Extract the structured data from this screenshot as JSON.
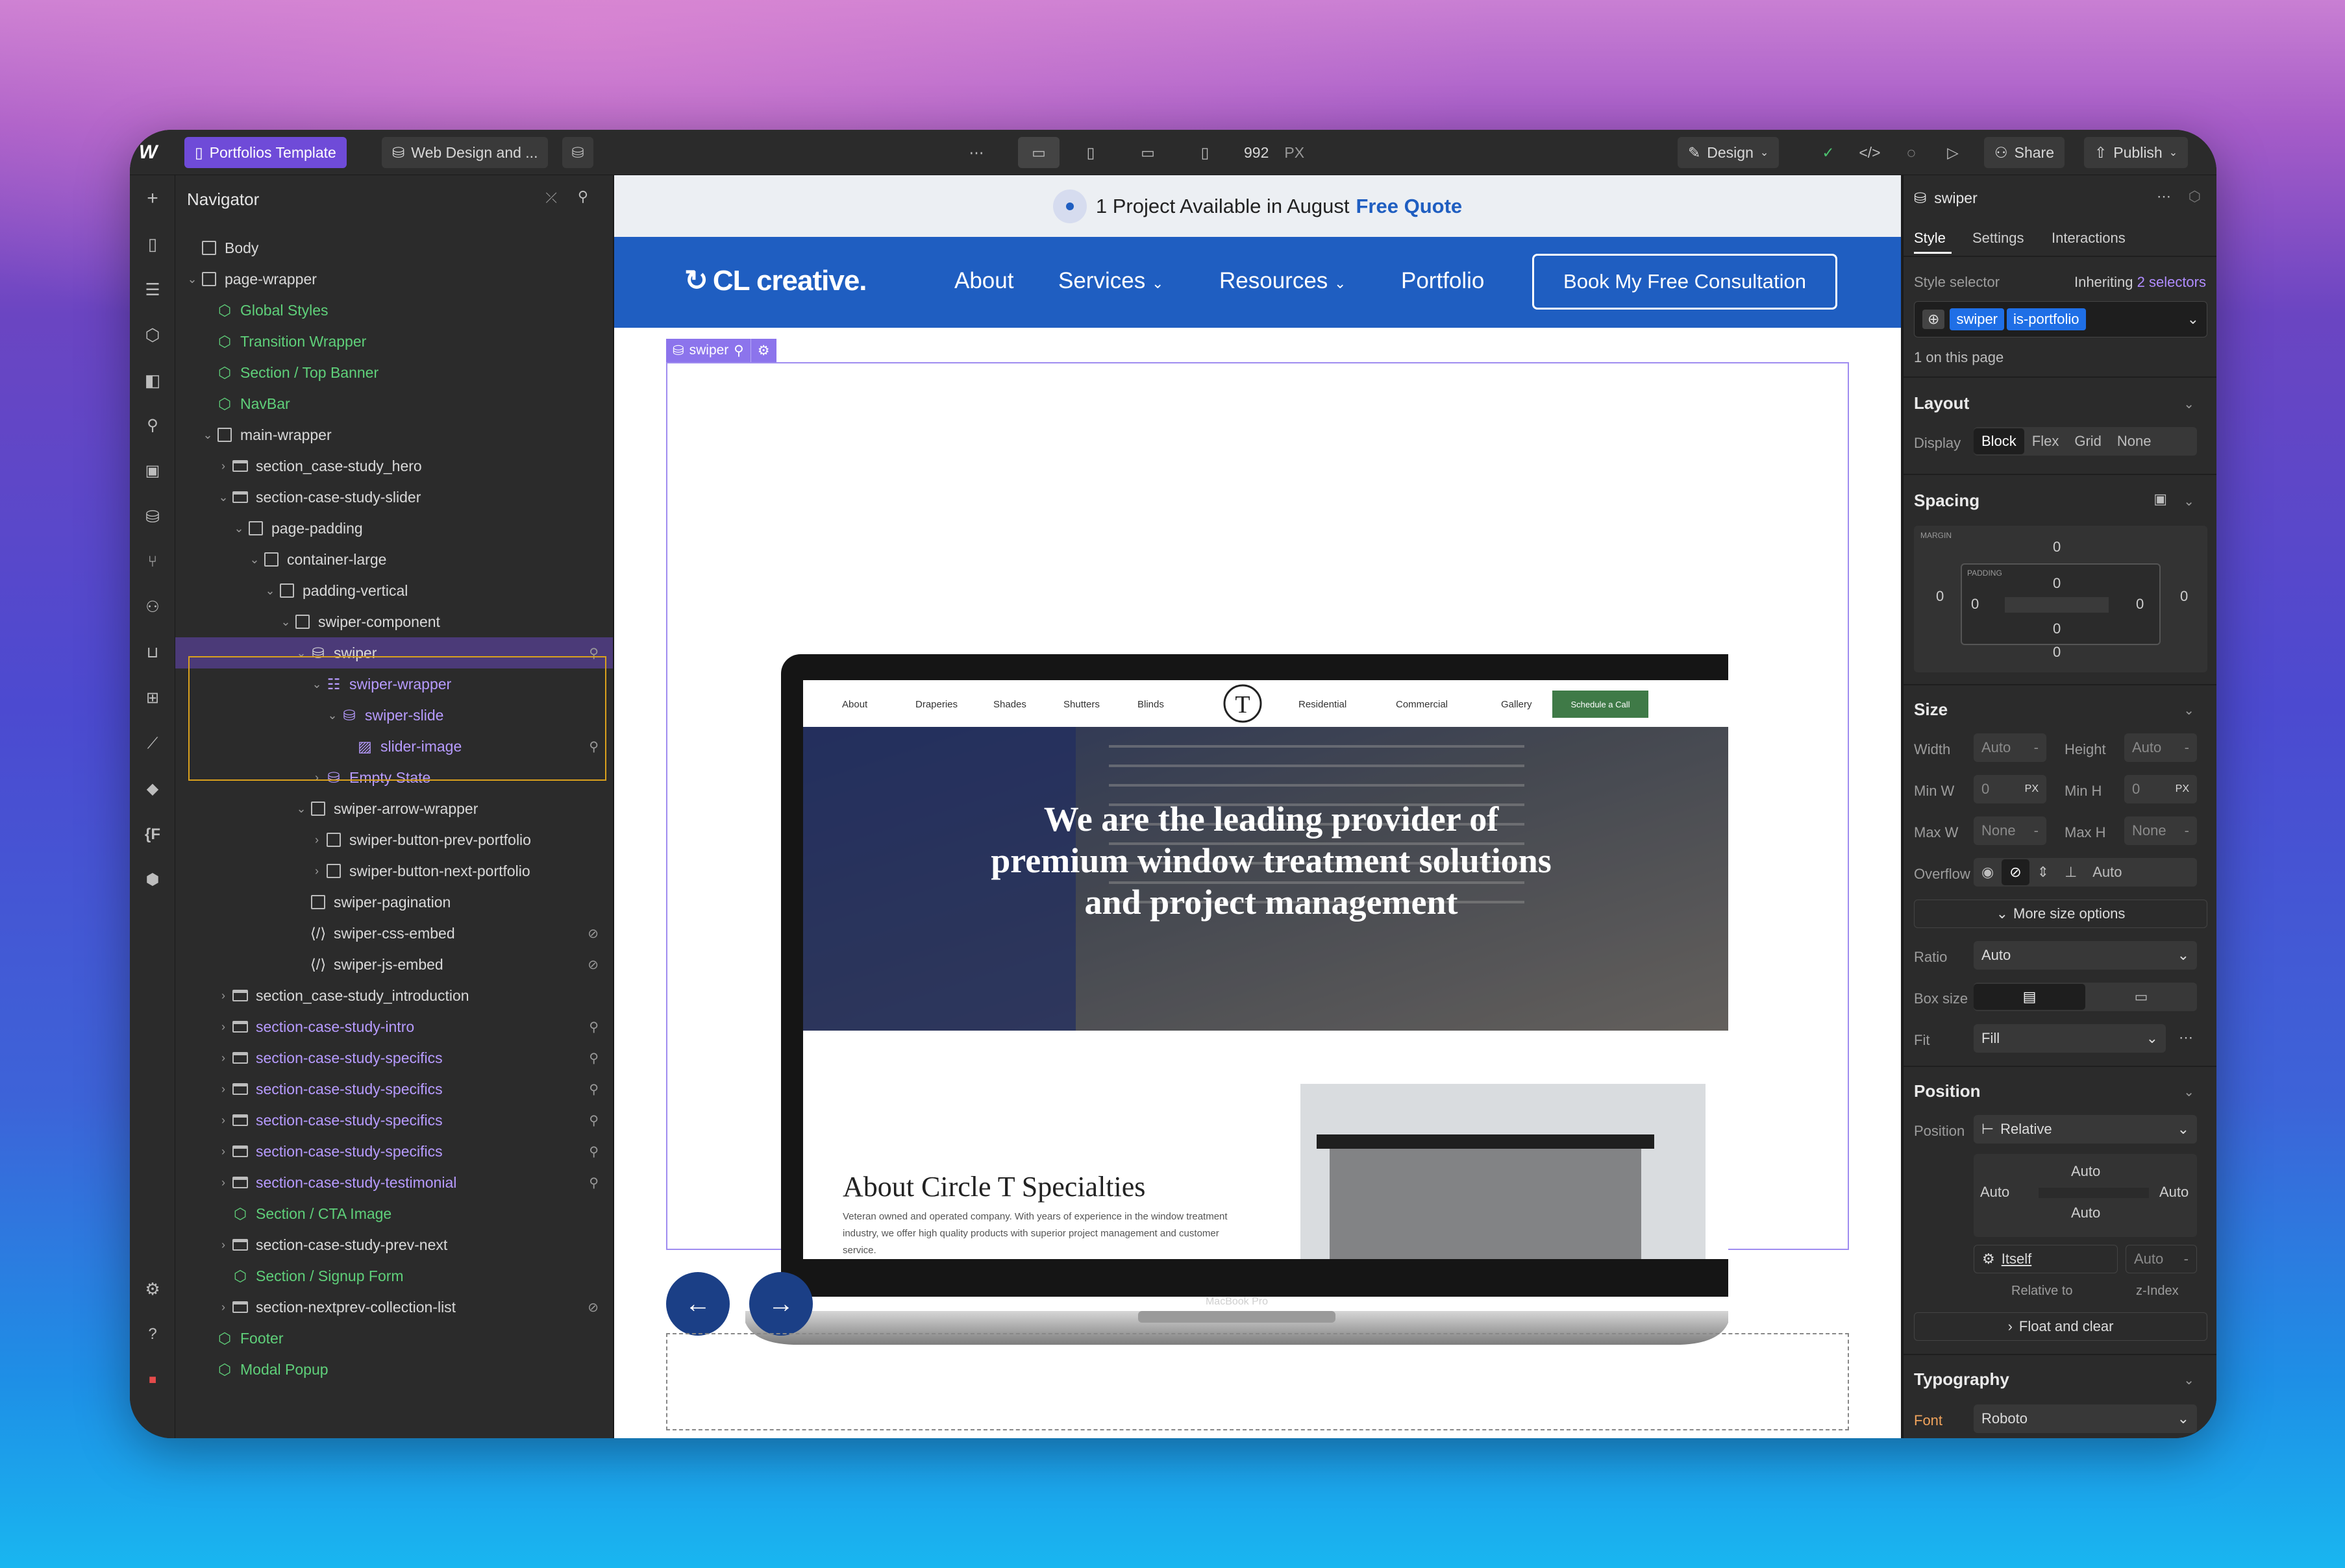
{
  "topbar": {
    "tab1": "Portfolios Template",
    "tab2": "Web Design and ...",
    "width_value": "992",
    "width_unit": "PX",
    "mode": "Design",
    "share": "Share",
    "publish": "Publish"
  },
  "navigator": {
    "title": "Navigator",
    "items": [
      {
        "label": "Body",
        "depth": 0,
        "type": "box"
      },
      {
        "label": "page-wrapper",
        "depth": 0,
        "type": "box",
        "caret": "open"
      },
      {
        "label": "Global Styles",
        "depth": 1,
        "type": "comp"
      },
      {
        "label": "Transition Wrapper",
        "depth": 1,
        "type": "comp"
      },
      {
        "label": "Section / Top Banner",
        "depth": 1,
        "type": "comp"
      },
      {
        "label": "NavBar",
        "depth": 1,
        "type": "comp"
      },
      {
        "label": "main-wrapper",
        "depth": 1,
        "type": "box",
        "caret": "open"
      },
      {
        "label": "section_case-study_hero",
        "depth": 2,
        "type": "sec",
        "caret": "closed"
      },
      {
        "label": "section-case-study-slider",
        "depth": 2,
        "type": "sec",
        "caret": "open"
      },
      {
        "label": "page-padding",
        "depth": 3,
        "type": "box",
        "caret": "open"
      },
      {
        "label": "container-large",
        "depth": 4,
        "type": "box",
        "caret": "open"
      },
      {
        "label": "padding-vertical",
        "depth": 5,
        "type": "box",
        "caret": "open"
      },
      {
        "label": "swiper-component",
        "depth": 6,
        "type": "box",
        "caret": "open"
      },
      {
        "label": "swiper",
        "depth": 7,
        "type": "cmsdb",
        "caret": "open",
        "selected": true
      },
      {
        "label": "swiper-wrapper",
        "depth": 8,
        "type": "cmslist",
        "caret": "open"
      },
      {
        "label": "swiper-slide",
        "depth": 9,
        "type": "cmsitem",
        "caret": "open"
      },
      {
        "label": "slider-image",
        "depth": 10,
        "type": "img"
      },
      {
        "label": "Empty State",
        "depth": 8,
        "type": "cmsempty",
        "caret": "closed"
      },
      {
        "label": "swiper-arrow-wrapper",
        "depth": 7,
        "type": "box",
        "caret": "open"
      },
      {
        "label": "swiper-button-prev-portfolio",
        "depth": 8,
        "type": "box",
        "caret": "closed"
      },
      {
        "label": "swiper-button-next-portfolio",
        "depth": 8,
        "type": "box",
        "caret": "closed"
      },
      {
        "label": "swiper-pagination",
        "depth": 7,
        "type": "box"
      },
      {
        "label": "swiper-css-embed",
        "depth": 7,
        "type": "embed"
      },
      {
        "label": "swiper-js-embed",
        "depth": 7,
        "type": "embed"
      },
      {
        "label": "section_case-study_introduction",
        "depth": 2,
        "type": "sec",
        "caret": "closed"
      },
      {
        "label": "section-case-study-intro",
        "depth": 2,
        "type": "secp",
        "caret": "closed"
      },
      {
        "label": "section-case-study-specifics",
        "depth": 2,
        "type": "secp",
        "caret": "closed"
      },
      {
        "label": "section-case-study-specifics",
        "depth": 2,
        "type": "secp",
        "caret": "closed"
      },
      {
        "label": "section-case-study-specifics",
        "depth": 2,
        "type": "secp",
        "caret": "closed"
      },
      {
        "label": "section-case-study-specifics",
        "depth": 2,
        "type": "secp",
        "caret": "closed"
      },
      {
        "label": "section-case-study-testimonial",
        "depth": 2,
        "type": "secp",
        "caret": "closed"
      },
      {
        "label": "Section / CTA Image",
        "depth": 2,
        "type": "comp"
      },
      {
        "label": "section-case-study-prev-next",
        "depth": 2,
        "type": "sec",
        "caret": "closed"
      },
      {
        "label": "Section / Signup Form",
        "depth": 2,
        "type": "comp"
      },
      {
        "label": "section-nextprev-collection-list",
        "depth": 2,
        "type": "sec",
        "caret": "closed"
      },
      {
        "label": "Footer",
        "depth": 1,
        "type": "comp"
      },
      {
        "label": "Modal Popup",
        "depth": 1,
        "type": "comp"
      }
    ]
  },
  "canvas": {
    "announcement": "1 Project Available in August",
    "announcement_link": "Free Quote",
    "logo": "CL creative.",
    "nav": [
      "About",
      "Services",
      "Resources",
      "Portfolio"
    ],
    "cta": "Book My Free Consultation",
    "swiper_tag": "swiper",
    "mock": {
      "menu": [
        "About",
        "Draperies",
        "Shades",
        "Shutters",
        "Blinds",
        "Residential",
        "Commercial",
        "Gallery"
      ],
      "menu_btn": "Schedule a Call",
      "monogram": "T",
      "hero": "We are the leading provider of premium window treatment solutions and project management",
      "about_title": "About Circle T Specialties",
      "about_text": "Veteran owned and operated company. With years of experience in the window treatment industry, we offer high quality products with superior project management and customer service.",
      "laptop_label": "MacBook Pro"
    }
  },
  "panel": {
    "element": "swiper",
    "tabs": [
      "Style",
      "Settings",
      "Interactions"
    ],
    "style_selector": "Style selector",
    "inheriting": "Inheriting",
    "selectors_count": "2 selectors",
    "chips": [
      "swiper",
      "is-portfolio"
    ],
    "on_page": "1 on this page",
    "layout": {
      "title": "Layout",
      "display_label": "Display",
      "options": [
        "Block",
        "Flex",
        "Grid",
        "None"
      ]
    },
    "spacing": {
      "title": "Spacing",
      "margin_label": "MARGIN",
      "padding_label": "PADDING",
      "margin": {
        "top": "0",
        "right": "0",
        "bottom": "0",
        "left": "0"
      },
      "padding": {
        "top": "0",
        "right": "0",
        "bottom": "0",
        "left": "0"
      }
    },
    "size": {
      "title": "Size",
      "width_label": "Width",
      "height_label": "Height",
      "width": "Auto",
      "height": "Auto",
      "minw_label": "Min W",
      "minh_label": "Min H",
      "minw": "0",
      "minh": "0",
      "unit": "PX",
      "maxw_label": "Max W",
      "maxh_label": "Max H",
      "maxw": "None",
      "maxh": "None",
      "overflow_label": "Overflow",
      "overflow_auto": "Auto",
      "more": "More size options",
      "ratio_label": "Ratio",
      "ratio": "Auto",
      "boxsize_label": "Box size",
      "fit_label": "Fit",
      "fit": "Fill"
    },
    "position": {
      "title": "Position",
      "label": "Position",
      "value": "Relative",
      "top": "Auto",
      "left": "Auto",
      "right": "Auto",
      "bottom": "Auto",
      "relative_to_value": "Itself",
      "z_value": "Auto",
      "relative_to_label": "Relative to",
      "z_label": "z-Index",
      "float": "Float and clear"
    },
    "typography": {
      "title": "Typography",
      "font_label": "Font",
      "font": "Roboto"
    }
  }
}
